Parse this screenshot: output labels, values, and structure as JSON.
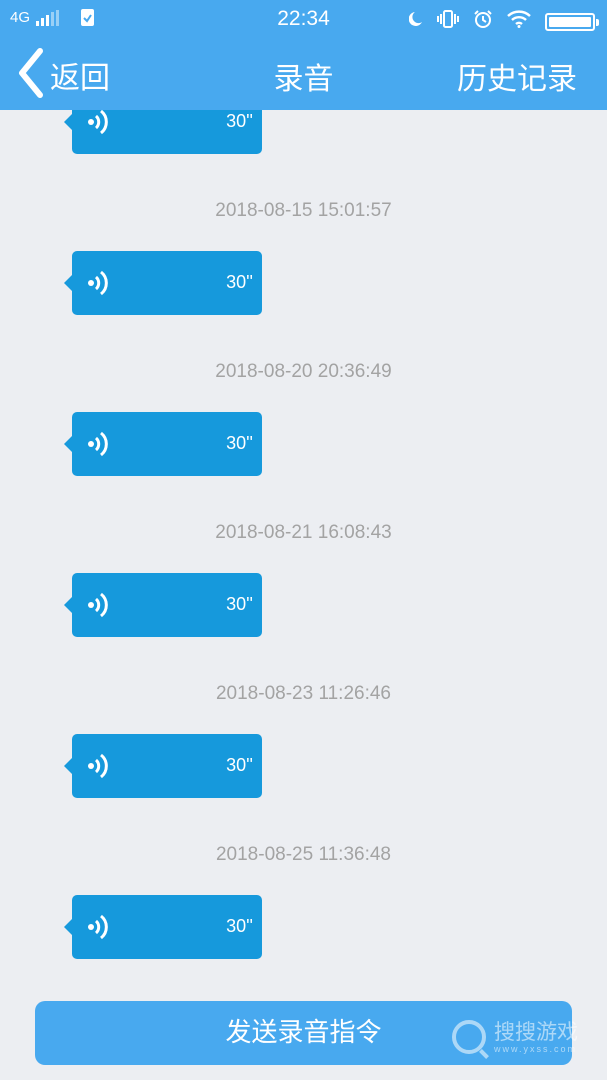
{
  "status_bar": {
    "network": "4G",
    "time": "22:34",
    "icons": [
      "signal-icon",
      "clipboard-check-icon",
      "moon-icon",
      "vibrate-icon",
      "alarm-icon",
      "wifi-icon",
      "battery-icon"
    ]
  },
  "header": {
    "back_label": "返回",
    "title": "录音",
    "history_label": "历史记录"
  },
  "messages": [
    {
      "timestamp": "",
      "duration": "30''"
    },
    {
      "timestamp": "2018-08-15 15:01:57",
      "duration": "30''"
    },
    {
      "timestamp": "2018-08-20 20:36:49",
      "duration": "30''"
    },
    {
      "timestamp": "2018-08-21 16:08:43",
      "duration": "30''"
    },
    {
      "timestamp": "2018-08-23 11:26:46",
      "duration": "30''"
    },
    {
      "timestamp": "2018-08-25 11:36:48",
      "duration": "30''"
    }
  ],
  "footer": {
    "send_label": "发送录音指令"
  },
  "watermark": {
    "text": "搜搜游戏",
    "subtext": "www.yxss.com"
  },
  "colors": {
    "header_bg": "#48a9ef",
    "bubble_bg": "#1699dc",
    "page_bg": "#eceef2",
    "timestamp_text": "#a3a3a3"
  }
}
